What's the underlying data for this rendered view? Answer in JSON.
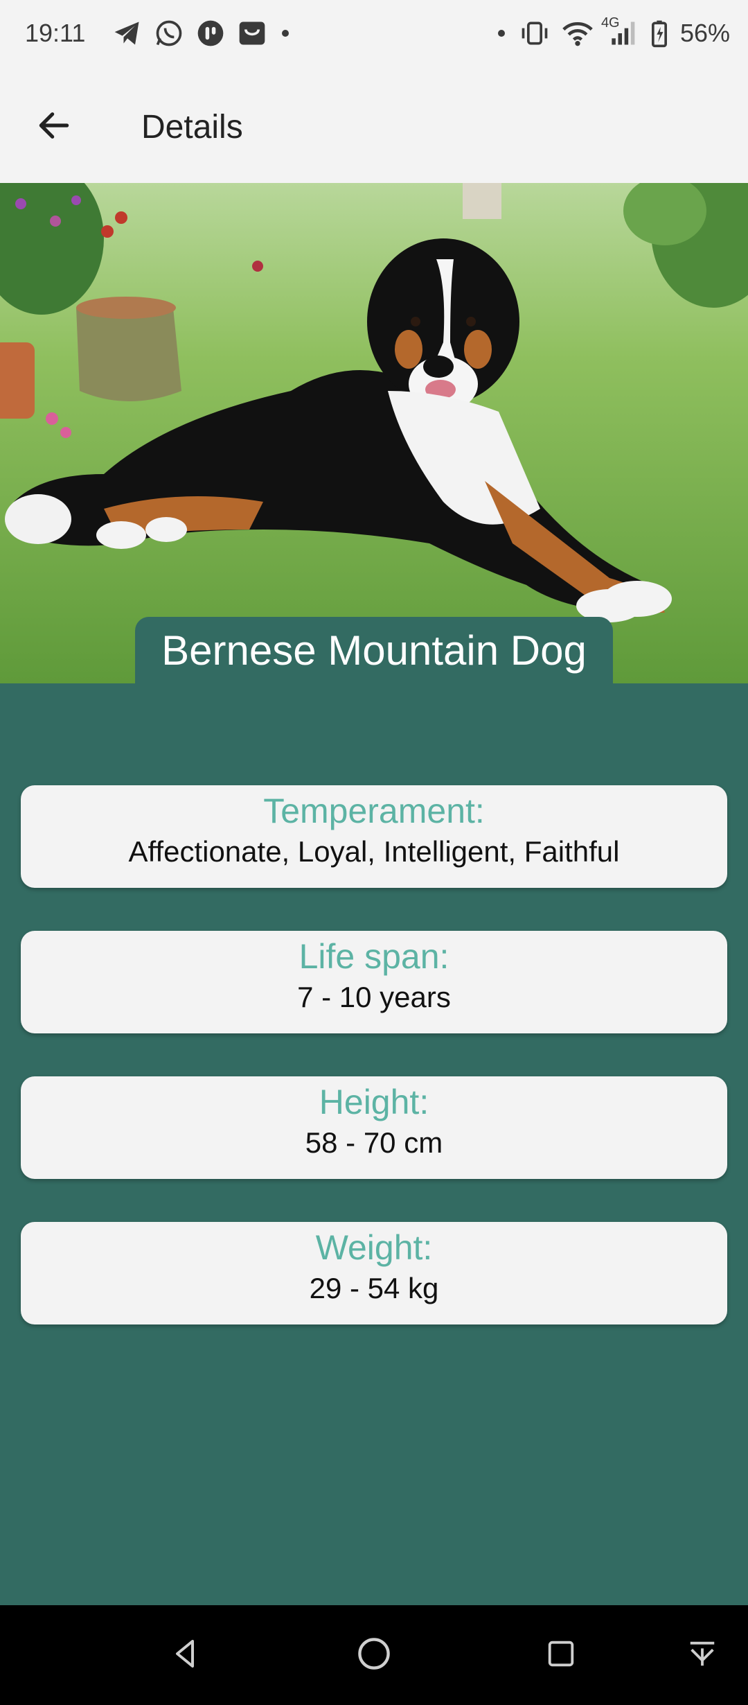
{
  "status_bar": {
    "time": "19:11",
    "battery": "56%",
    "network": "4G",
    "left_icons": [
      "telegram-icon",
      "whatsapp-icon",
      "app-icon",
      "shopping-icon",
      "dot-icon"
    ],
    "right_icons": [
      "dot-icon",
      "vibrate-icon",
      "wifi-icon",
      "signal-icon",
      "battery-charging-icon"
    ]
  },
  "app_bar": {
    "back_icon": "arrow-back-icon",
    "title": "Details"
  },
  "breed": {
    "name": "Bernese Mountain Dog",
    "photo_icon": "dog-photo"
  },
  "details": [
    {
      "label": "Temperament:",
      "value": "Affectionate, Loyal, Intelligent, Faithful"
    },
    {
      "label": "Life span:",
      "value": "7 - 10 years"
    },
    {
      "label": "Height:",
      "value": "58 - 70 cm"
    },
    {
      "label": "Weight:",
      "value": "29 - 54 kg"
    }
  ],
  "nav_bar": {
    "icons": [
      "back-triangle-icon",
      "home-circle-icon",
      "recents-square-icon",
      "notification-pull-icon"
    ]
  },
  "colors": {
    "background": "#336b62",
    "label_accent": "#5cb3a4",
    "surface": "#f3f3f3"
  }
}
